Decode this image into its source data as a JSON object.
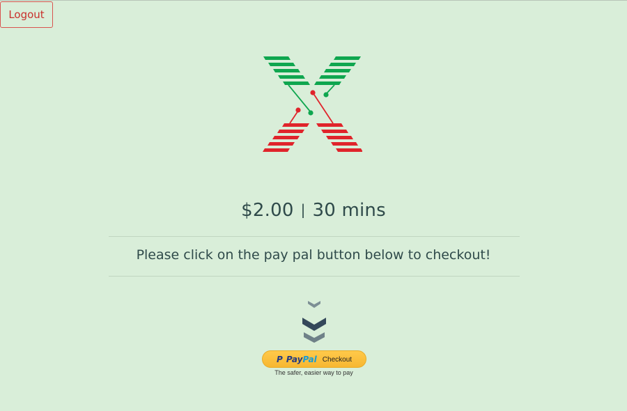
{
  "header": {
    "logout_label": "Logout"
  },
  "logo": {
    "icon": "x-logo-icon",
    "colors": {
      "green": "#0fa64f",
      "red": "#e0242b"
    }
  },
  "pricing": {
    "amount": "$2.00",
    "separator": "|",
    "duration": "30 mins"
  },
  "instruction": "Please click on the pay pal button below to checkout!",
  "scroll_hint": {
    "icon": "chevrons-down-icon",
    "colors": {
      "light": "#7d8f95",
      "dark": "#34485a"
    }
  },
  "paypal": {
    "pay": "Pay",
    "pal": "Pal",
    "checkout_label": "Checkout",
    "tagline": "The safer, easier way to pay",
    "colors": {
      "button": "#ffc439",
      "pay": "#253b80",
      "pal": "#179bd7"
    }
  },
  "theme": {
    "background": "#d9eed9",
    "text": "#2f4a4a",
    "logout": "#c9302c"
  }
}
